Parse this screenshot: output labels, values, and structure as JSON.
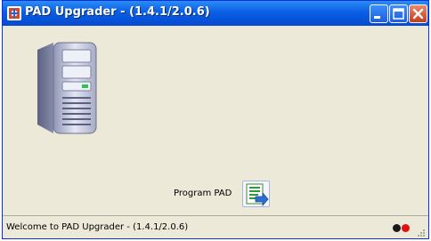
{
  "window": {
    "title": "PAD Upgrader - (1.4.1/2.0.6)",
    "app_icon": "app-icon",
    "controls": [
      "minimize-icon",
      "maximize-icon",
      "close-icon"
    ]
  },
  "main": {
    "server_icon": "server-tower-icon",
    "program_label": "Program PAD",
    "program_icon": "program-download-icon"
  },
  "statusbar": {
    "text": "Welcome to PAD Upgrader - (1.4.1/2.0.6)",
    "indicators": [
      "black",
      "red"
    ],
    "colors": {
      "indicator_1": "#1a1a1a",
      "indicator_2": "#e01010"
    }
  },
  "colors": {
    "titlebar": "#0a5fe3",
    "client_bg": "#ece9d8",
    "close_button": "#c43d1a"
  }
}
